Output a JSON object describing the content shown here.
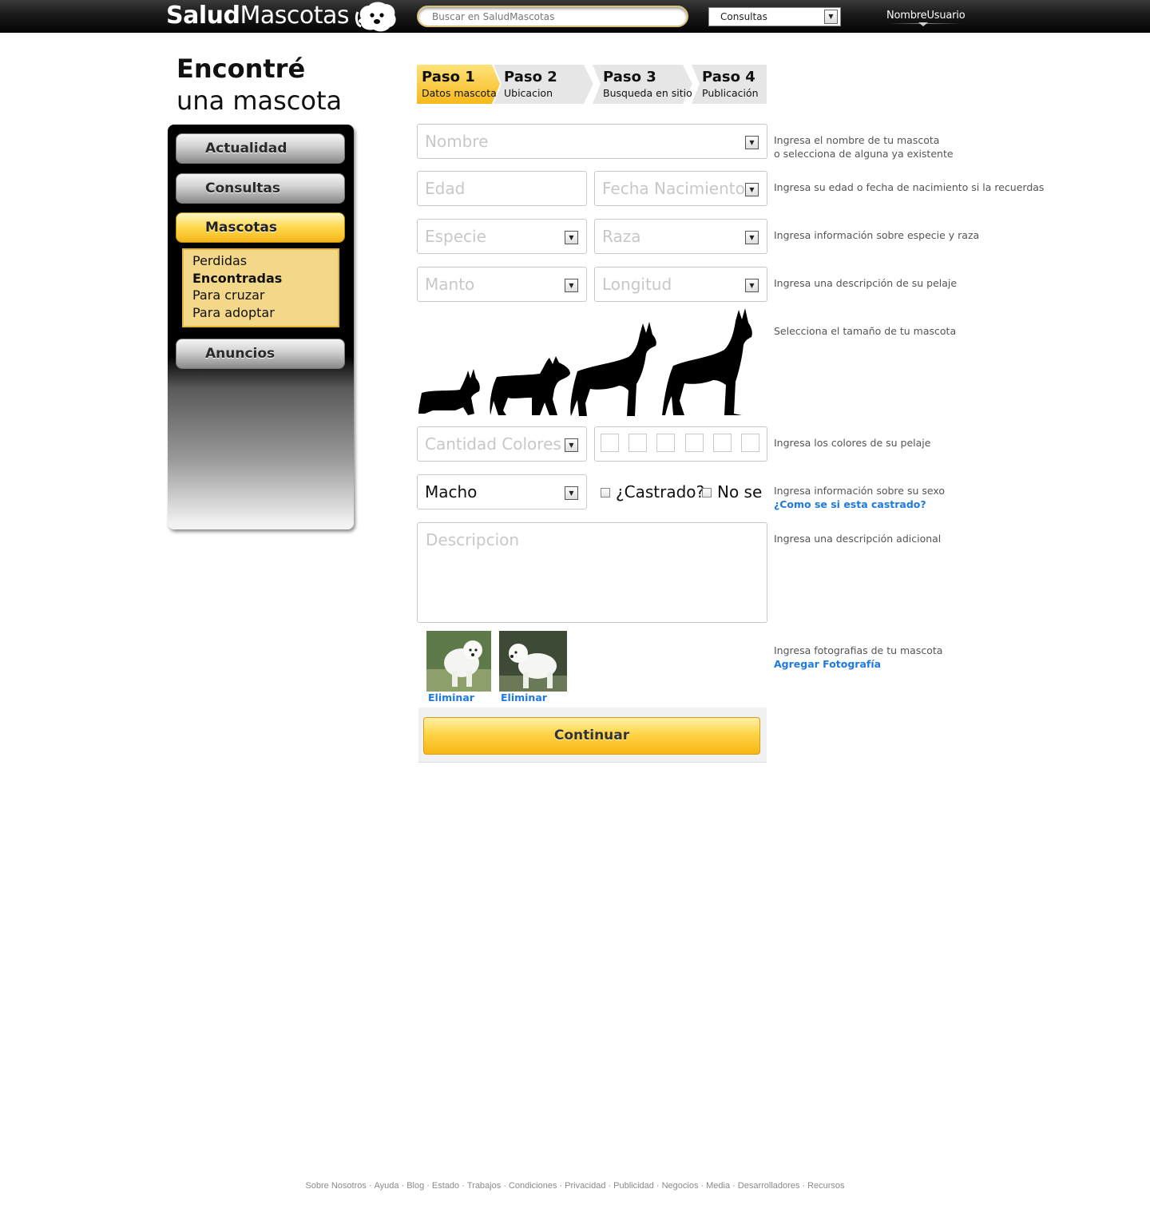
{
  "header": {
    "logo_bold": "Salud",
    "logo_light": "Mascotas",
    "search_placeholder": "Buscar en SaludMascotas",
    "category_select": "Consultas",
    "username": "NombreUsuario"
  },
  "page": {
    "title_line1": "Encontré",
    "title_line2": "una mascota"
  },
  "sidebar": {
    "items": [
      {
        "label": "Actualidad"
      },
      {
        "label": "Consultas"
      },
      {
        "label": "Mascotas"
      },
      {
        "label": "Anuncios"
      }
    ],
    "submenu": [
      "Perdidas",
      "Encontradas",
      "Para cruzar",
      "Para adoptar"
    ],
    "submenu_selected": "Encontradas"
  },
  "steps": [
    {
      "num": "Paso 1",
      "label": "Datos mascota",
      "active": true
    },
    {
      "num": "Paso 2",
      "label": "Ubicacion",
      "active": false
    },
    {
      "num": "Paso 3",
      "label": "Busqueda en sitio",
      "active": false
    },
    {
      "num": "Paso 4",
      "label": "Publicación",
      "active": false
    }
  ],
  "form": {
    "nombre_placeholder": "Nombre",
    "edad_placeholder": "Edad",
    "fecha_placeholder": "Fecha Nacimiento",
    "especie_placeholder": "Especie",
    "raza_placeholder": "Raza",
    "manto_placeholder": "Manto",
    "longitud_placeholder": "Longitud",
    "colores_placeholder": "Cantidad Colores",
    "sexo_value": "Macho",
    "castrado_label": "¿Castrado?",
    "nose_label": "No se",
    "descripcion_placeholder": "Descripcion",
    "remove_label": "Eliminar",
    "continue_label": "Continuar"
  },
  "help": {
    "nombre_l1": "Ingresa el nombre de tu mascota",
    "nombre_l2": "o selecciona de alguna ya existente",
    "edad": "Ingresa su edad o fecha de nacimiento si la recuerdas",
    "especie": "Ingresa información sobre especie y raza",
    "pelaje": "Ingresa una descripción de su pelaje",
    "tamano": "Selecciona el tamaño de tu mascota",
    "colores": "Ingresa los colores de su pelaje",
    "sexo": "Ingresa información sobre su sexo",
    "castrado_link": "¿Como se si esta castrado?",
    "descripcion": "Ingresa una descripción adicional",
    "fotos": "Ingresa fotografias de tu mascota",
    "agregar_link": "Agregar Fotografía"
  },
  "icons": {
    "sizes": [
      "small-dog-icon",
      "medium-dog-icon",
      "large-dog-icon",
      "giant-dog-icon"
    ],
    "dropdown": "dropdown-arrow-icon"
  },
  "colors": {
    "accent": "#ffd447",
    "link": "#1f7ae0",
    "topbar": "#1a1a1a"
  },
  "footer": {
    "links": [
      "Sobre Nosotros",
      "Ayuda",
      "Blog",
      "Estado",
      "Trabajos",
      "Condiciones",
      "Privacidad",
      "Publicidad",
      "Negocios",
      "Media",
      "Desarrolladores",
      "Recursos"
    ]
  }
}
